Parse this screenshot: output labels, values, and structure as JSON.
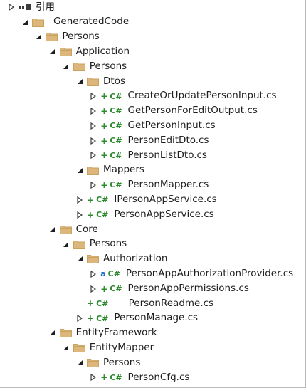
{
  "tree": [
    {
      "label": "引用",
      "kind": "ref",
      "state": "collapsed",
      "depth": 0
    },
    {
      "label": "_GeneratedCode",
      "kind": "folder",
      "state": "expanded",
      "depth": 1
    },
    {
      "label": "Persons",
      "kind": "folder",
      "state": "expanded",
      "depth": 2
    },
    {
      "label": "Application",
      "kind": "folder",
      "state": "expanded",
      "depth": 3
    },
    {
      "label": "Persons",
      "kind": "folder",
      "state": "expanded",
      "depth": 4
    },
    {
      "label": "Dtos",
      "kind": "folder",
      "state": "expanded",
      "depth": 5
    },
    {
      "label": "CreateOrUpdatePersonInput.cs",
      "kind": "cs",
      "state": "collapsed",
      "depth": 6
    },
    {
      "label": "GetPersonForEditOutput.cs",
      "kind": "cs",
      "state": "collapsed",
      "depth": 6
    },
    {
      "label": "GetPersonInput.cs",
      "kind": "cs",
      "state": "collapsed",
      "depth": 6
    },
    {
      "label": "PersonEditDto.cs",
      "kind": "cs",
      "state": "collapsed",
      "depth": 6
    },
    {
      "label": "PersonListDto.cs",
      "kind": "cs",
      "state": "collapsed",
      "depth": 6
    },
    {
      "label": "Mappers",
      "kind": "folder",
      "state": "expanded",
      "depth": 5
    },
    {
      "label": "PersonMapper.cs",
      "kind": "cs",
      "state": "collapsed",
      "depth": 6
    },
    {
      "label": "IPersonAppService.cs",
      "kind": "cs",
      "state": "collapsed",
      "depth": 5
    },
    {
      "label": "PersonAppService.cs",
      "kind": "cs",
      "state": "collapsed",
      "depth": 5
    },
    {
      "label": "Core",
      "kind": "folder",
      "state": "expanded",
      "depth": 3
    },
    {
      "label": "Persons",
      "kind": "folder",
      "state": "expanded",
      "depth": 4
    },
    {
      "label": "Authorization",
      "kind": "folder",
      "state": "expanded",
      "depth": 5
    },
    {
      "label": "PersonAppAuthorizationProvider.cs",
      "kind": "cs-lock",
      "state": "collapsed",
      "depth": 6
    },
    {
      "label": "PersonAppPermissions.cs",
      "kind": "cs",
      "state": "collapsed",
      "depth": 6
    },
    {
      "label": "___PersonReadme.cs",
      "kind": "cs",
      "state": "none",
      "depth": 5
    },
    {
      "label": "PersonManage.cs",
      "kind": "cs",
      "state": "collapsed",
      "depth": 5
    },
    {
      "label": "EntityFramework",
      "kind": "folder",
      "state": "expanded",
      "depth": 3
    },
    {
      "label": "EntityMapper",
      "kind": "folder",
      "state": "expanded",
      "depth": 4
    },
    {
      "label": "Persons",
      "kind": "folder",
      "state": "expanded",
      "depth": 5
    },
    {
      "label": "PersonCfg.cs",
      "kind": "cs",
      "state": "collapsed",
      "depth": 6
    }
  ],
  "icons": {
    "cs_badge": "C#",
    "cs_plus": "+",
    "lock": "a"
  },
  "colors": {
    "folder": "#dcb67a",
    "folder_dark": "#c9a25e",
    "cs_green": "#2e8b2e",
    "lock_blue": "#1e6fc8"
  }
}
